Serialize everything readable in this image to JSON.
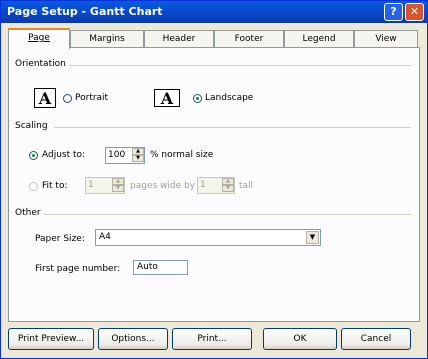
{
  "window": {
    "title": "Page Setup - Gantt Chart",
    "help_glyph": "?",
    "close_glyph": "✕"
  },
  "tabs": [
    {
      "label": "Page",
      "active": true
    },
    {
      "label": "Margins"
    },
    {
      "label": "Header"
    },
    {
      "label": "Footer"
    },
    {
      "label": "Legend"
    },
    {
      "label": "View"
    }
  ],
  "orientation": {
    "heading": "Orientation",
    "icon_letter": "A",
    "portrait_label": "Portrait",
    "landscape_label": "Landscape",
    "selected": "landscape"
  },
  "scaling": {
    "heading": "Scaling",
    "adjust_label": "Adjust to:",
    "adjust_value": "100",
    "adjust_suffix": "% normal size",
    "fit_label": "Fit to:",
    "pages_wide_value": "1",
    "pages_wide_label": "pages wide by",
    "tall_value": "1",
    "tall_label": "tall",
    "selected": "adjust"
  },
  "other": {
    "heading": "Other",
    "paper_size_label": "Paper Size:",
    "paper_size_value": "A4",
    "first_page_label": "First page number:",
    "first_page_value": "Auto"
  },
  "buttons": {
    "print_preview": "Print Preview...",
    "options": "Options...",
    "print": "Print...",
    "ok": "OK",
    "cancel": "Cancel"
  }
}
